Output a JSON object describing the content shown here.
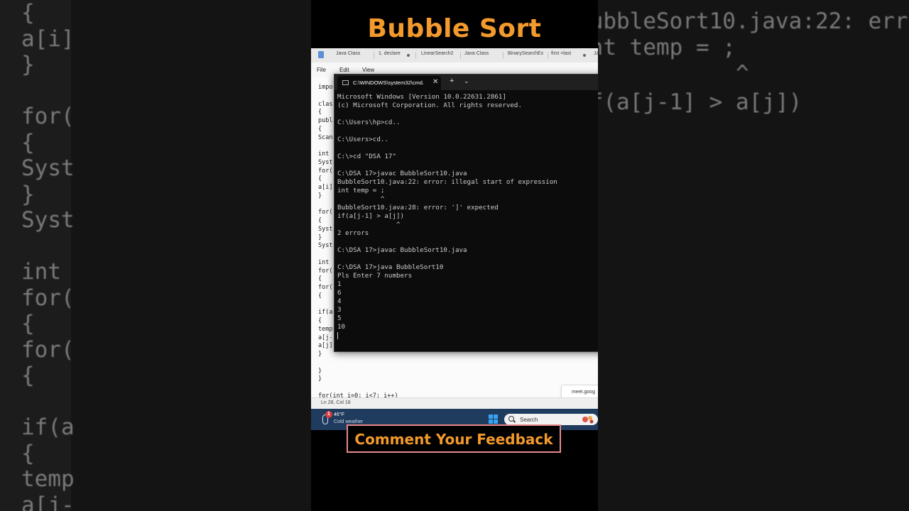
{
  "video": {
    "title": "Bubble Sort",
    "feedback_label": "Comment Your Feedback"
  },
  "background": {
    "left_lines": [
      "{",
      "a[i]",
      "}",
      "",
      "for(",
      "{",
      "Syst",
      "}",
      "Syst",
      "",
      "int",
      "for(",
      "{",
      "for(",
      "{",
      "",
      "if(a",
      "{",
      "temp",
      "a[j-"
    ],
    "right_lines": [
      "BubbleSort10.java:22: error: illegal start of expression",
      "int temp = ;",
      "            ^",
      "",
      "BubbleSort10.java:28: error: ']' expected",
      "if(a[j-1] > a[j])",
      "               ^",
      "2 errors",
      "",
      "C:\\DSA 17>javac BubbleSort10.java",
      "",
      "C:\\DSA 17>java BubbleSort10",
      "Pls Enter 7 numbers",
      "1",
      "6",
      "4",
      "3",
      "5",
      "10"
    ]
  },
  "editor": {
    "tabs": [
      "Java Class",
      "1. declare",
      "LinearSearch2",
      "Java Class",
      "BinarySearchEx",
      "first =last",
      "Ja"
    ],
    "menu": [
      "File",
      "Edit",
      "View"
    ],
    "code_lines": [
      "impo",
      "",
      "clas",
      "{",
      "publ",
      "{",
      "Scan",
      "",
      "int",
      "Syst",
      "for(",
      "{",
      "a[i]",
      "}",
      "",
      "for(",
      "{",
      "Syst",
      "}",
      "Syst",
      "",
      "int",
      "for(",
      "{",
      "for(",
      "{",
      "",
      "if(a",
      "{",
      "temp",
      "a[j-",
      "a[j]",
      "}",
      "",
      "}",
      "}",
      "",
      "for(int i=0; i<7; i++)"
    ],
    "status": "Ln 28, Col 18",
    "notification": "meet.goog"
  },
  "taskbar": {
    "weather_badge": "1",
    "temperature": "46°F",
    "weather_desc": "Cold weather",
    "search_label": "Search"
  },
  "cmd": {
    "tab_title": "C:\\WINDOWS\\system32\\cmd.",
    "close_glyph": "✕",
    "plus_glyph": "+",
    "chevron_glyph": "⌄",
    "lines": [
      "Microsoft Windows [Version 10.0.22631.2861]",
      "(c) Microsoft Corporation. All rights reserved.",
      "",
      "C:\\Users\\hp>cd..",
      "",
      "C:\\Users>cd..",
      "",
      "C:\\>cd \"DSA 17\"",
      "",
      "C:\\DSA 17>javac BubbleSort10.java",
      "BubbleSort10.java:22: error: illegal start of expression",
      "int temp = ;",
      "           ^",
      "BubbleSort10.java:28: error: ']' expected",
      "if(a[j-1] > a[j])",
      "               ^",
      "2 errors",
      "",
      "C:\\DSA 17>javac BubbleSort10.java",
      "",
      "C:\\DSA 17>java BubbleSort10",
      "Pls Enter 7 numbers",
      "1",
      "6",
      "4",
      "3",
      "5",
      "10"
    ]
  }
}
